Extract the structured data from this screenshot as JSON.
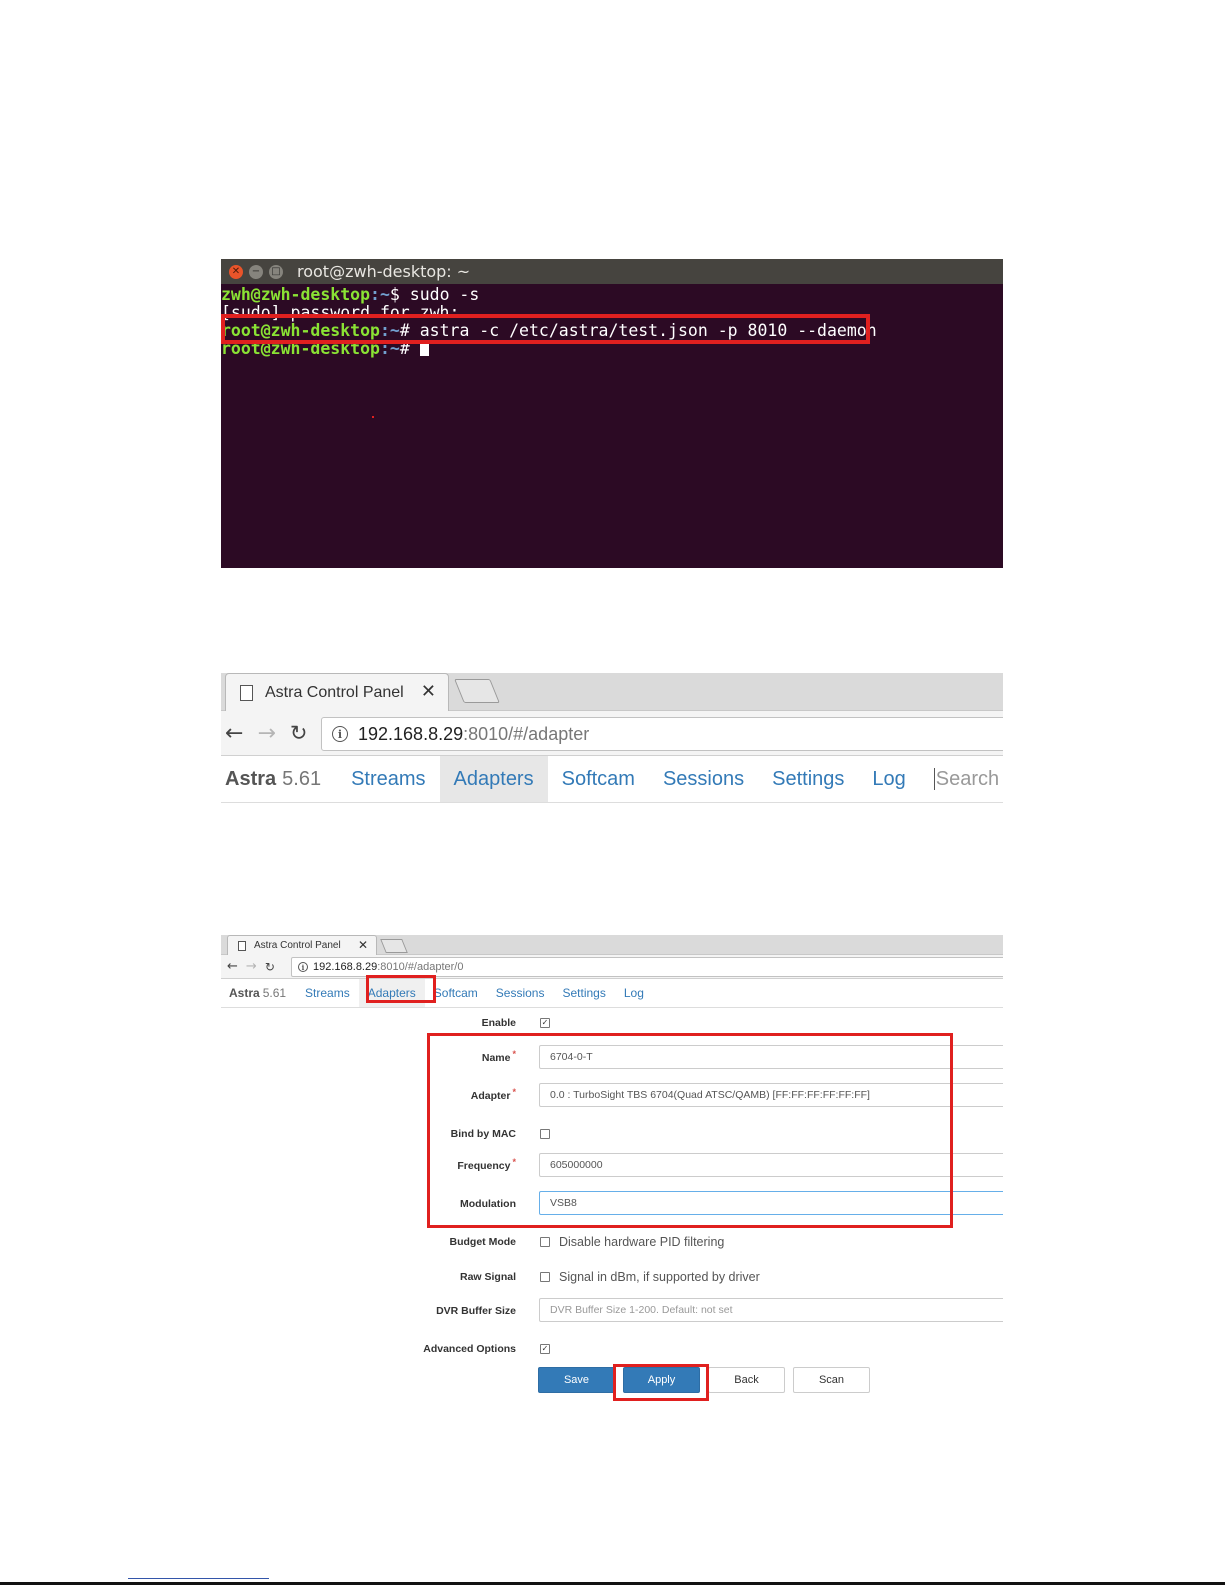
{
  "terminal": {
    "title": "root@zwh-desktop: ~",
    "lines": [
      {
        "user": "zwh@zwh-desktop",
        "path": ":~",
        "prompt": "$ ",
        "cmd": "sudo -s"
      },
      {
        "plain": "[sudo] password for zwh:"
      },
      {
        "user": "root@zwh-desktop",
        "path": ":~",
        "prompt": "# ",
        "cmd": "astra -c /etc/astra/test.json -p 8010 --daemon"
      },
      {
        "user": "root@zwh-desktop",
        "path": ":~",
        "prompt": "# ",
        "cmd": ""
      }
    ],
    "colors": {
      "background": "#2c0a24",
      "user": "#8ae234",
      "path": "#729fcf",
      "highlight": "#e0201f"
    }
  },
  "browser1": {
    "tab_title": "Astra Control Panel",
    "url_host": "192.168.8.29",
    "url_rest": ":8010/#/adapter",
    "brand": {
      "name": "Astra",
      "version": "5.61"
    },
    "nav": [
      {
        "label": "Streams",
        "active": false
      },
      {
        "label": "Adapters",
        "active": true
      },
      {
        "label": "Softcam",
        "active": false
      },
      {
        "label": "Sessions",
        "active": false
      },
      {
        "label": "Settings",
        "active": false
      },
      {
        "label": "Log",
        "active": false
      }
    ],
    "search_placeholder": "Search"
  },
  "browser2": {
    "tab_title": "Astra Control Panel",
    "url_host": "192.168.8.29",
    "url_rest": ":8010/#/adapter/0",
    "brand": {
      "name": "Astra",
      "version": "5.61"
    },
    "nav": [
      {
        "label": "Streams",
        "active": false
      },
      {
        "label": "Adapters",
        "active": true
      },
      {
        "label": "Softcam",
        "active": false
      },
      {
        "label": "Sessions",
        "active": false
      },
      {
        "label": "Settings",
        "active": false
      },
      {
        "label": "Log",
        "active": false
      }
    ],
    "form": {
      "enable": {
        "label": "Enable",
        "checked": true
      },
      "name": {
        "label": "Name",
        "value": "6704-0-T",
        "required": true
      },
      "adapter": {
        "label": "Adapter",
        "value": "0.0 : TurboSight TBS 6704(Quad ATSC/QAMB) [FF:FF:FF:FF:FF:FF]",
        "required": true
      },
      "bind_by_mac": {
        "label": "Bind by MAC",
        "checked": false
      },
      "frequency": {
        "label": "Frequency",
        "value": "605000000",
        "required": true
      },
      "modulation": {
        "label": "Modulation",
        "value": "VSB8"
      },
      "budget_mode": {
        "label": "Budget Mode",
        "checked": false,
        "hint": "Disable hardware PID filtering"
      },
      "raw_signal": {
        "label": "Raw Signal",
        "checked": false,
        "hint": "Signal in dBm, if supported by driver"
      },
      "dvr_buffer": {
        "label": "DVR Buffer Size",
        "placeholder": "DVR Buffer Size 1-200. Default: not set"
      },
      "advanced": {
        "label": "Advanced Options",
        "checked": true
      }
    },
    "buttons": {
      "save": "Save",
      "apply": "Apply",
      "back": "Back",
      "scan": "Scan"
    },
    "colors": {
      "primary": "#337ab7",
      "highlight": "#e0201f",
      "required": "#d9534f"
    }
  }
}
